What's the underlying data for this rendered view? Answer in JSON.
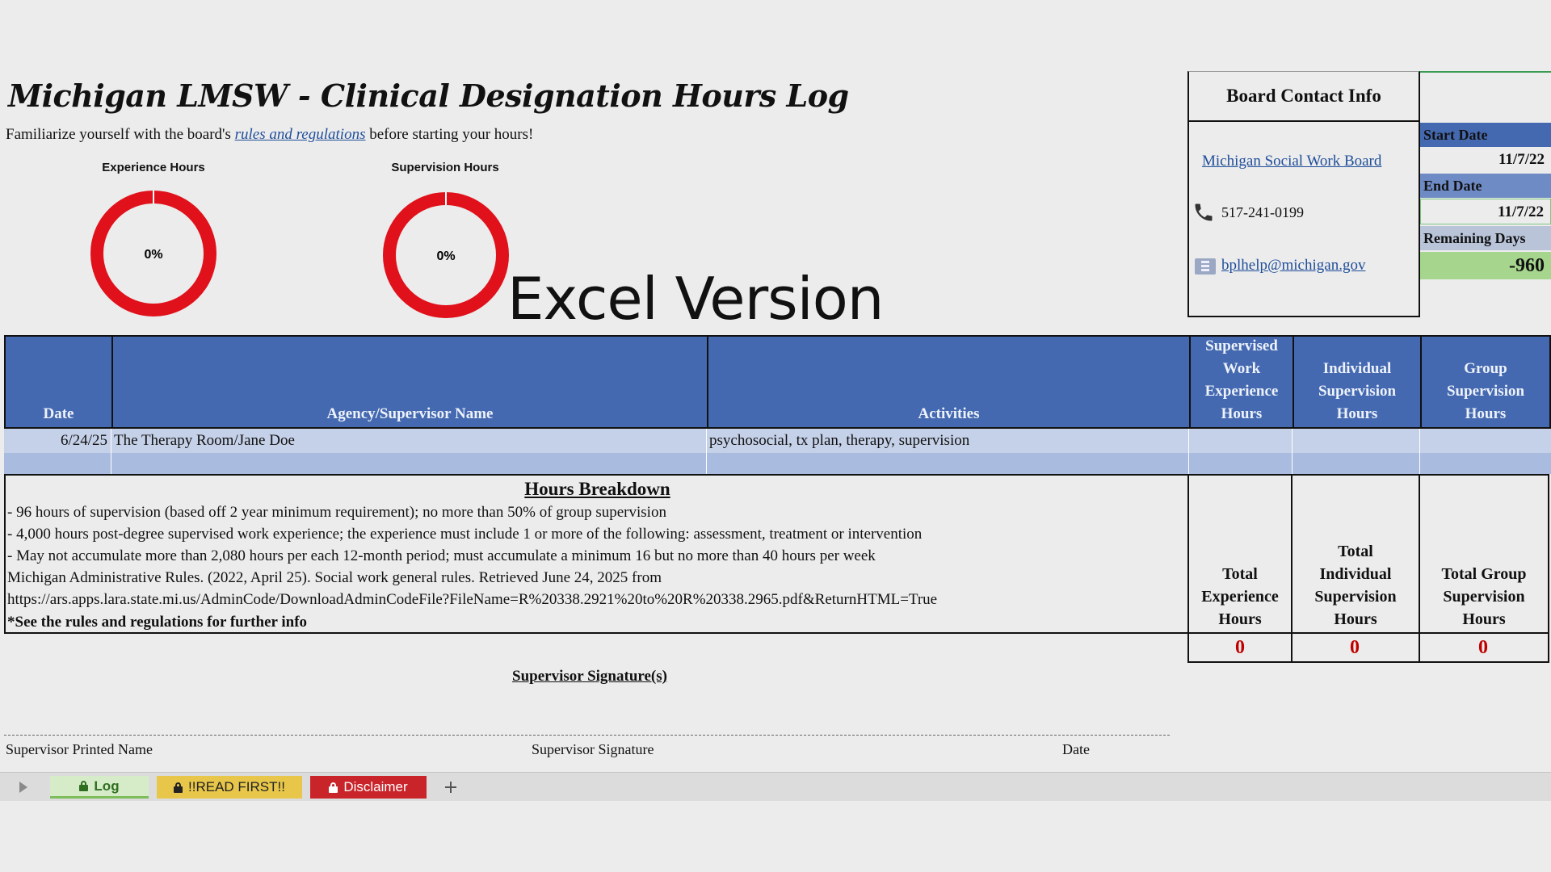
{
  "header": {
    "title": "Michigan LMSW - Clinical Designation Hours Log",
    "intro_before": "Familiarize yourself with the board's ",
    "intro_link": "rules and regulations",
    "intro_after": " before starting your hours!"
  },
  "gauges": [
    {
      "label": "Experience Hours",
      "value_text": "0%",
      "value": 0
    },
    {
      "label": "Supervision Hours",
      "value_text": "0%",
      "value": 0
    }
  ],
  "watermark": "Excel Version",
  "contact": {
    "title": "Board Contact Info",
    "board_link": "Michigan Social Work Board",
    "phone": "517-241-0199",
    "email": "bplhelp@michigan.gov"
  },
  "dates": {
    "start_label": "Start Date",
    "start_value": "11/7/22",
    "end_label": "End Date",
    "end_value": "11/7/22",
    "remaining_label": "Remaining Days",
    "remaining_value": "-960"
  },
  "table": {
    "headers": [
      "Date",
      "Agency/Supervisor Name",
      "Activities",
      "Supervised Work Experience Hours",
      "Individual Supervision Hours",
      "Group Supervision Hours"
    ],
    "rows": [
      {
        "date": "6/24/25",
        "agency": "The Therapy Room/Jane Doe",
        "activities": "psychosocial, tx plan, therapy, supervision",
        "work": "",
        "individual": "",
        "group": ""
      },
      {
        "date": "",
        "agency": "",
        "activities": "",
        "work": "",
        "individual": "",
        "group": ""
      }
    ]
  },
  "breakdown": {
    "title": "Hours Breakdown",
    "lines": [
      "- 96 hours of supervision (based off 2 year minimum requirement); no more than 50% of group supervision",
      "- 4,000 hours post-degree supervised work experience; the experience must include 1 or more of the following: assessment, treatment or intervention",
      "- May not accumulate more than 2,080 hours per each 12-month period; must accumulate a minimum 16 but no more than 40 hours per week",
      "Michigan Administrative Rules. (2022, April 25). Social work general rules. Retrieved June 24, 2025 from",
      "https://ars.apps.lara.state.mi.us/AdminCode/DownloadAdminCodeFile?FileName=R%20338.2921%20to%20R%20338.2965.pdf&ReturnHTML=True",
      "*See the rules and regulations for further info"
    ]
  },
  "totals": [
    {
      "label": "Total Experience Hours",
      "value": "0"
    },
    {
      "label": "Total Individual Supervision Hours",
      "value": "0"
    },
    {
      "label": "Total Group Supervision Hours",
      "value": "0"
    }
  ],
  "signature": {
    "title": "Supervisor Signature(s)",
    "printed_name": "Supervisor Printed Name",
    "signature": "Supervisor Signature",
    "date": "Date"
  },
  "tabs": [
    {
      "label": "Log",
      "color": "#7dbd5a"
    },
    {
      "label": "!!READ FIRST!!",
      "color": "#e7c64a"
    },
    {
      "label": "Disclaimer",
      "color": "#c8242a"
    }
  ],
  "colors": {
    "header_blue": "#4469b0",
    "gauge_red": "#e0111b",
    "total_red": "#c00000",
    "remaining_green": "#a6d58e"
  }
}
